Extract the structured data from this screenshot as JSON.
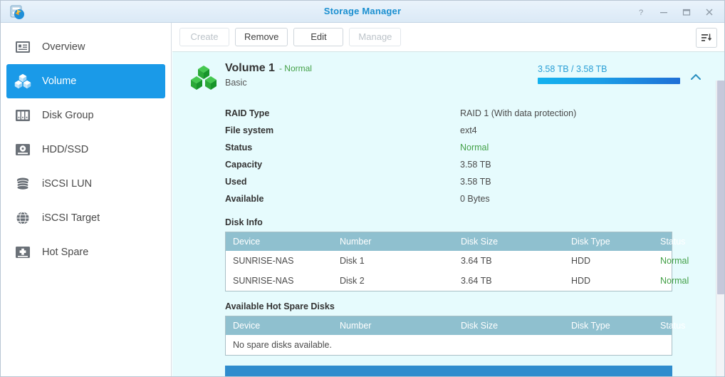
{
  "window": {
    "title": "Storage Manager",
    "app_icon": "storage-manager-icon",
    "controls": [
      {
        "name": "help",
        "glyph": "?"
      },
      {
        "name": "minimize",
        "glyph": "–"
      },
      {
        "name": "maximize",
        "glyph": "□"
      },
      {
        "name": "close",
        "glyph": "✕"
      }
    ]
  },
  "sidebar": {
    "items": [
      {
        "label": "Overview",
        "icon": "overview-icon",
        "active": false
      },
      {
        "label": "Volume",
        "icon": "volume-cubes-icon",
        "active": true
      },
      {
        "label": "Disk Group",
        "icon": "disk-group-icon",
        "active": false
      },
      {
        "label": "HDD/SSD",
        "icon": "hdd-ssd-icon",
        "active": false
      },
      {
        "label": "iSCSI LUN",
        "icon": "iscsi-lun-icon",
        "active": false
      },
      {
        "label": "iSCSI Target",
        "icon": "iscsi-target-icon",
        "active": false
      },
      {
        "label": "Hot Spare",
        "icon": "hot-spare-icon",
        "active": false
      }
    ]
  },
  "toolbar": {
    "buttons": [
      {
        "label": "Create",
        "disabled": true
      },
      {
        "label": "Remove",
        "disabled": false
      },
      {
        "label": "Edit",
        "disabled": false
      },
      {
        "label": "Manage",
        "disabled": true
      }
    ],
    "sort_button": "sort-list-icon"
  },
  "volume": {
    "icon": "green-cubes-icon",
    "name": "Volume 1",
    "status_inline": "- Normal",
    "subtitle": "Basic",
    "capacity_label": "3.58 TB / 3.58 TB",
    "capacity_percent": 100,
    "collapse_icon": "chevron-up-icon",
    "details": [
      {
        "key": "RAID Type",
        "value": "RAID 1 (With data protection)",
        "ok": false
      },
      {
        "key": "File system",
        "value": "ext4",
        "ok": false
      },
      {
        "key": "Status",
        "value": "Normal",
        "ok": true
      },
      {
        "key": "Capacity",
        "value": "3.58 TB",
        "ok": false
      },
      {
        "key": "Used",
        "value": "3.58 TB",
        "ok": false
      },
      {
        "key": "Available",
        "value": "0 Bytes",
        "ok": false
      }
    ]
  },
  "disk_info": {
    "title": "Disk Info",
    "columns": [
      "Device",
      "Number",
      "Disk Size",
      "Disk Type",
      "Status"
    ],
    "rows": [
      {
        "device": "SUNRISE-NAS",
        "number": "Disk 1",
        "size": "3.64 TB",
        "type": "HDD",
        "status": "Normal"
      },
      {
        "device": "SUNRISE-NAS",
        "number": "Disk 2",
        "size": "3.64 TB",
        "type": "HDD",
        "status": "Normal"
      }
    ]
  },
  "hot_spare": {
    "title": "Available Hot Spare Disks",
    "columns": [
      "Device",
      "Number",
      "Disk Size",
      "Disk Type",
      "Status"
    ],
    "empty_message": "No spare disks available."
  },
  "colors": {
    "accent_blue": "#1a9ae8",
    "title_blue": "#1a8fd0",
    "panel_bg": "#e6fbfd",
    "table_header": "#8fc0cf",
    "status_green": "#43a047",
    "next_bar_blue": "#2f8ccd"
  }
}
